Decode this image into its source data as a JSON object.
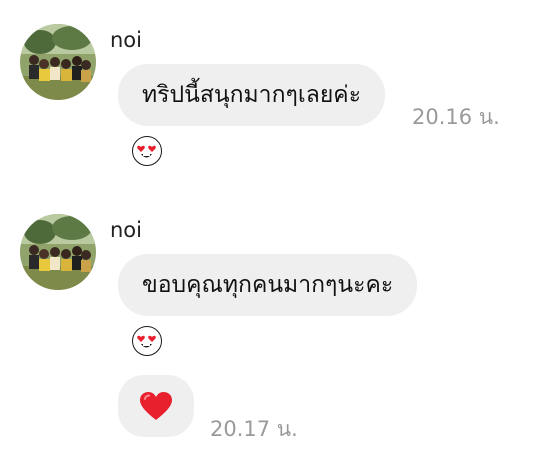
{
  "messages": [
    {
      "sender": "noi",
      "text": "ทริปนี้สนุกมากๆเลยค่ะ",
      "time": "20.16 น.",
      "reaction_icon": "heart-eyes-emoji-icon"
    },
    {
      "sender": "noi",
      "text": "ขอบคุณทุกคนมากๆนะคะ",
      "reaction_icon": "heart-eyes-emoji-icon"
    }
  ],
  "heart_message": {
    "icon": "red-heart-icon",
    "time": "20.17 น."
  },
  "colors": {
    "bubble": "#efefef",
    "time_text": "#9a9a9a",
    "heart": "#e8202e"
  }
}
